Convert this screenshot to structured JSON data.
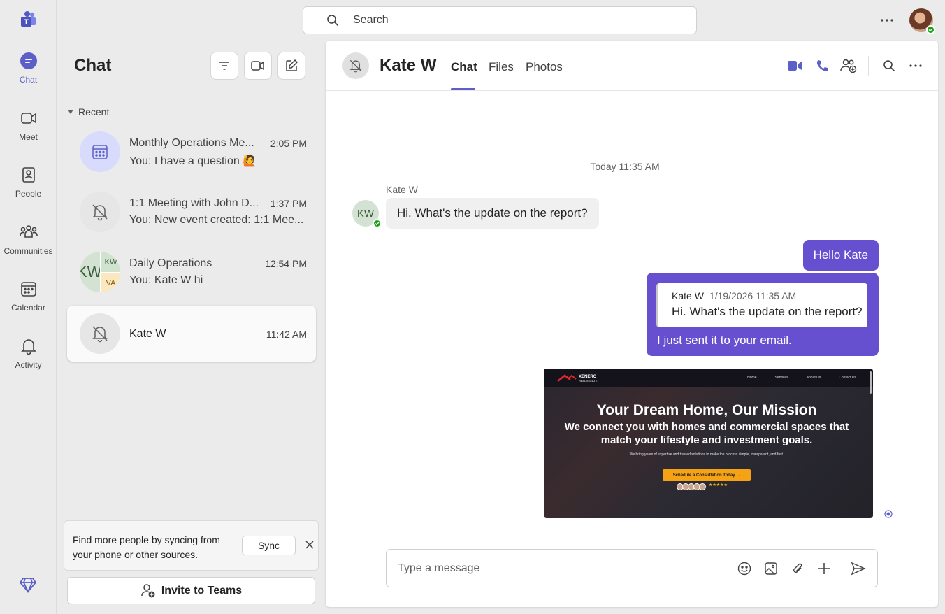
{
  "rail": {
    "items": [
      {
        "label": "Chat",
        "icon": "chat-icon"
      },
      {
        "label": "Meet",
        "icon": "video-icon"
      },
      {
        "label": "People",
        "icon": "people-icon"
      },
      {
        "label": "Communities",
        "icon": "communities-icon"
      },
      {
        "label": "Calendar",
        "icon": "calendar-icon"
      },
      {
        "label": "Activity",
        "icon": "bell-icon"
      }
    ],
    "active": "Chat"
  },
  "search": {
    "placeholder": "Search"
  },
  "chat_pane": {
    "title": "Chat",
    "section": "Recent",
    "chats": [
      {
        "name": "Monthly Operations Me...",
        "time": "2:05 PM",
        "preview": "You: I have a question 🙋"
      },
      {
        "name": "1:1 Meeting with John D...",
        "time": "1:37 PM",
        "preview": "You: New event created: 1:1 Mee..."
      },
      {
        "name": "Daily Operations",
        "time": "12:54 PM",
        "preview": "You: Kate W hi",
        "avatar_initials": [
          "KW",
          "KW",
          "VA"
        ]
      },
      {
        "name": "Kate W",
        "time": "11:42 AM",
        "preview": ""
      }
    ],
    "sync_card": {
      "text": "Find more people by syncing from your phone or other sources.",
      "button": "Sync"
    },
    "invite_label": "Invite to Teams"
  },
  "conversation": {
    "title": "Kate W",
    "tabs": [
      "Chat",
      "Files",
      "Photos"
    ],
    "active_tab": "Chat",
    "day_label": "Today 11:35 AM",
    "messages": {
      "incoming_sender": "Kate W",
      "incoming_initials": "KW",
      "incoming_text": "Hi. What's the update on the report?",
      "outgoing_1": "Hello Kate",
      "quote_author": "Kate W",
      "quote_date": "1/19/2026 11:35 AM",
      "quote_text": "Hi. What's the update on the report?",
      "outgoing_2": "I just sent it to your email."
    },
    "attachment": {
      "brand": "XENERO",
      "brand_sub": "REAL ESTATE",
      "nav_links": [
        "Home",
        "Services",
        "About Us",
        "Contact Us"
      ],
      "headline": "Your Dream Home, Our Mission",
      "subheadline": "We connect you with homes and commercial spaces that match your lifestyle and investment goals.",
      "body": "We bring years of expertise and trusted solutions to make the process simple, transparent, and fast.",
      "cta": "Schedule a Consultation Today →",
      "rating": "★★★★★"
    },
    "composer": {
      "placeholder": "Type a message"
    }
  },
  "colors": {
    "accent": "#5b5fc7",
    "bubble_out": "#6650d0",
    "presence": "#13a10e"
  }
}
